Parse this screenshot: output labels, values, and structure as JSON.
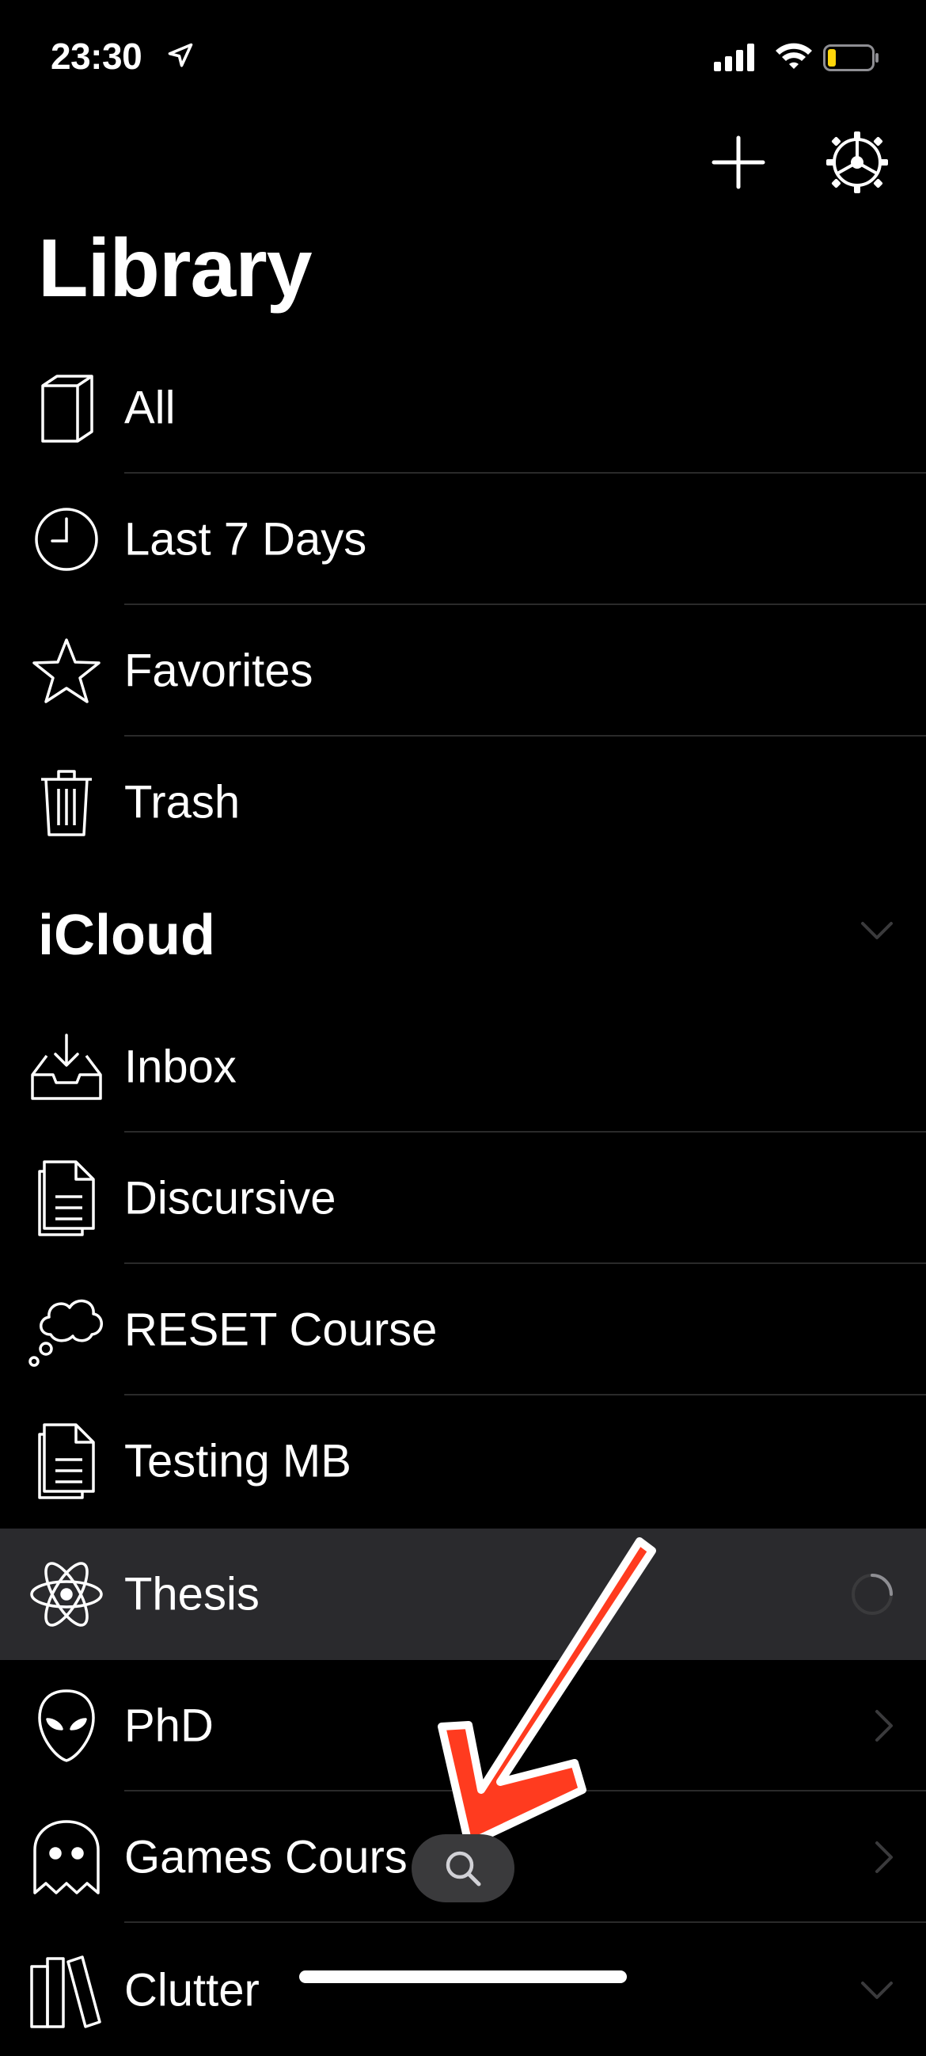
{
  "status_bar": {
    "time": "23:30"
  },
  "page_title": "Library",
  "library_items": [
    {
      "label": "All",
      "icon": "book-icon"
    },
    {
      "label": "Last 7 Days",
      "icon": "clock-icon"
    },
    {
      "label": "Favorites",
      "icon": "star-icon"
    },
    {
      "label": "Trash",
      "icon": "trash-icon"
    }
  ],
  "section": {
    "title": "iCloud"
  },
  "icloud_items": [
    {
      "label": "Inbox",
      "icon": "inbox-icon"
    },
    {
      "label": "Discursive",
      "icon": "document-icon"
    },
    {
      "label": "RESET Course",
      "icon": "thought-bubble-icon"
    },
    {
      "label": "Testing MB",
      "icon": "document-icon"
    },
    {
      "label": "Thesis",
      "icon": "atom-icon",
      "selected": true
    },
    {
      "label": "PhD",
      "icon": "alien-icon"
    },
    {
      "label": "Games Cours",
      "icon": "ghost-icon"
    },
    {
      "label": "Clutter",
      "icon": "books-icon"
    }
  ],
  "colors": {
    "background": "#000000",
    "selected_row": "#2a2a2d",
    "separator": "#2a2a2a",
    "annotation_arrow": "#ff3b1f"
  }
}
